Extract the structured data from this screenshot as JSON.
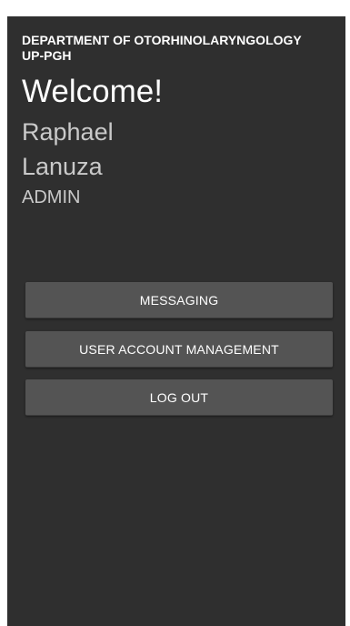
{
  "header": {
    "department_line1": "DEPARTMENT OF OTORHINOLARYNGOLOGY",
    "department_line2": "UP-PGH"
  },
  "greeting": {
    "welcome": "Welcome!",
    "first_name": "Raphael",
    "last_name": "Lanuza",
    "role": "ADMIN"
  },
  "menu": {
    "messaging_label": "MESSAGING",
    "user_account_management_label": "USER ACCOUNT MANAGEMENT",
    "logout_label": "LOG OUT"
  },
  "colors": {
    "background": "#2f2f2f",
    "button": "#545454",
    "primary_text": "#ffffff",
    "secondary_text": "#c9c9c9"
  }
}
